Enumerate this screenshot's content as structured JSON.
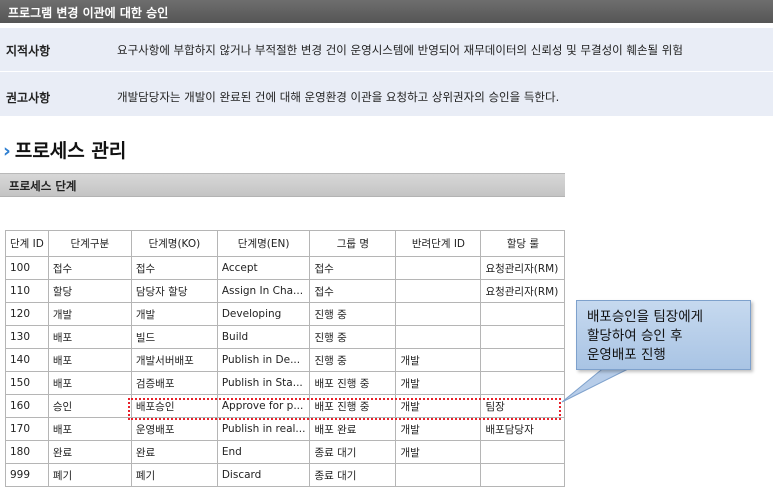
{
  "header": {
    "title": "프로그램 변경 이관에 대한 승인"
  },
  "findings": {
    "finding_label": "지적사항",
    "finding_text": "요구사항에 부합하지 않거나 부적절한 변경 건이 운영시스템에 반영되어 재무데이터의 신뢰성 및 무결성이 훼손될 위험",
    "rec_label": "권고사항",
    "rec_text": "개발담당자는 개발이 완료된 건에 대해 운영환경 이관을 요청하고 상위권자의 승인을 득한다."
  },
  "section": {
    "chevron": "›",
    "title": "프로세스 관리",
    "subtitle": "프로세스 단계"
  },
  "table": {
    "columns": [
      "단계 ID",
      "단계구분",
      "단계명(KO)",
      "단계명(EN)",
      "그룹 명",
      "반려단계 ID",
      "할당 룰"
    ],
    "rows": [
      [
        "100",
        "접수",
        "접수",
        "Accept",
        "접수",
        "",
        "요청관리자(RM)"
      ],
      [
        "110",
        "할당",
        "담당자 할당",
        "Assign In Cha...",
        "접수",
        "",
        "요청관리자(RM)"
      ],
      [
        "120",
        "개발",
        "개발",
        "Developing",
        "진행 중",
        "",
        ""
      ],
      [
        "130",
        "배포",
        "빌드",
        "Build",
        "진행 중",
        "",
        ""
      ],
      [
        "140",
        "배포",
        "개발서버배포",
        "Publish in De...",
        "진행 중",
        "개발",
        ""
      ],
      [
        "150",
        "배포",
        "검증배포",
        "Publish in Sta...",
        "배포 진행 중",
        "개발",
        ""
      ],
      [
        "160",
        "승인",
        "배포승인",
        "Approve for p...",
        "배포 진행 중",
        "개발",
        "팀장"
      ],
      [
        "170",
        "배포",
        "운영배포",
        "Publish in real...",
        "배포 완료",
        "개발",
        "배포담당자"
      ],
      [
        "180",
        "완료",
        "완료",
        "End",
        "종료 대기",
        "개발",
        ""
      ],
      [
        "999",
        "폐기",
        "폐기",
        "Discard",
        "종료 대기",
        "",
        ""
      ]
    ]
  },
  "callout": {
    "line1": "배포승인을 팀장에게",
    "line2": "할당하여 승인 후",
    "line3": "운영배포 진행"
  },
  "colors": {
    "header_bg": "#5f5f5f",
    "findings_bg": "#e9edf6",
    "highlight": "#e8202a",
    "callout_bg": "#b9cfea",
    "chevron": "#2f7fd1"
  }
}
